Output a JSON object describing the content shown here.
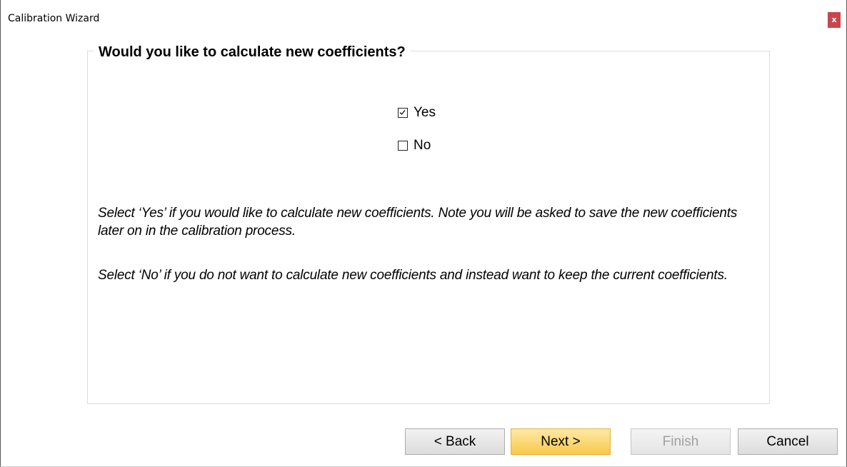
{
  "window": {
    "title": "Calibration Wizard",
    "close_label": "x"
  },
  "group": {
    "title": "Would you like to calculate new coefficients?"
  },
  "options": {
    "yes": {
      "label": "Yes",
      "checked": true
    },
    "no": {
      "label": "No",
      "checked": false
    }
  },
  "description": {
    "p1": "Select ‘Yes’ if you would like to calculate new coefficients.  Note you will be asked to save the new coefficients later on in the calibration process.",
    "p2": "Select ‘No’ if you do not want to calculate new coefficients and instead want to keep the current coefficients."
  },
  "buttons": {
    "back": "< Back",
    "next": "Next >",
    "finish": "Finish",
    "cancel": "Cancel"
  },
  "colors": {
    "close_bg": "#c8464b",
    "next_bg": "#f8c94a",
    "disabled_text": "#a0a0a0"
  },
  "icons": {
    "checkbox_checked": "checkmark-icon",
    "close": "close-icon"
  }
}
